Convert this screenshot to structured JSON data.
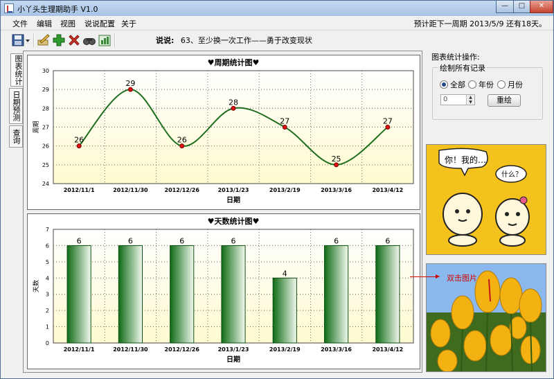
{
  "window": {
    "title": "小丫头生理期助手 V1.0",
    "buttons": {
      "minimize": "—",
      "maximize": "□",
      "close": "✕"
    }
  },
  "menu": {
    "items": [
      "文件",
      "编辑",
      "视图",
      "说说配置",
      "关于"
    ],
    "countdown": "预计距下一周期 2013/5/9 还有18天。"
  },
  "toolbar": {
    "icons": [
      "save-icon",
      "dropdown-icon",
      "edit-icon",
      "add-icon",
      "delete-icon",
      "search-icon",
      "chart-icon"
    ],
    "quote_label": "说说:",
    "quote_text": "63、至少换一次工作——勇于改变现状"
  },
  "tabs": [
    "图表统计",
    "日期预测",
    "查询"
  ],
  "charts": {
    "top_title": "♥周期统计图♥",
    "bottom_title": "♥天数统计图♥",
    "xlabel": "日期",
    "top_ylabel": "周期",
    "bottom_ylabel": "天数"
  },
  "chart_data": [
    {
      "type": "line",
      "title": "♥周期统计图♥",
      "xlabel": "日期",
      "ylabel": "周期",
      "categories": [
        "2012/11/1",
        "2012/11/30",
        "2012/12/26",
        "2013/1/23",
        "2013/2/19",
        "2013/3/16",
        "2013/4/12"
      ],
      "values": [
        26,
        29,
        26,
        28,
        27,
        25,
        27
      ],
      "ylim": [
        24,
        30
      ],
      "yticks": [
        24,
        25,
        26,
        27,
        28,
        29,
        30
      ],
      "grid": true,
      "colors": {
        "line": "#1f6e1f",
        "marker": "#e01010",
        "plot_bg": "#fffbd0"
      }
    },
    {
      "type": "bar",
      "title": "♥天数统计图♥",
      "xlabel": "日期",
      "ylabel": "天数",
      "categories": [
        "2012/11/1",
        "2012/11/30",
        "2012/12/26",
        "2013/1/23",
        "2013/2/19",
        "2013/3/16",
        "2013/4/12"
      ],
      "values": [
        6,
        6,
        6,
        6,
        4,
        6,
        6
      ],
      "ylim": [
        0,
        7
      ],
      "yticks": [
        0,
        1,
        2,
        3,
        4,
        5,
        6,
        7
      ],
      "grid": true,
      "colors": {
        "bar_dark": "#0f6b16",
        "bar_light": "#f2f9ee",
        "plot_bg": "#fffbd0"
      }
    }
  ],
  "right_panel": {
    "title": "图表统计操作:",
    "group_label": "绘制所有记录",
    "radios": [
      {
        "label": "全部",
        "checked": true
      },
      {
        "label": "年份",
        "checked": false
      },
      {
        "label": "月份",
        "checked": false
      }
    ],
    "spin_value": "0",
    "redraw_button": "重绘",
    "picture_hint": "双击图片",
    "cartoon_text_left": "你！我的…",
    "cartoon_text_right": "什么？"
  }
}
